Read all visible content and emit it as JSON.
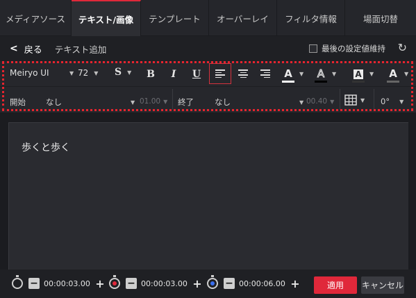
{
  "tabs": [
    "メディアソース",
    "テキスト/画像",
    "テンプレート",
    "オーバーレイ",
    "フィルタ情報",
    "場面切替"
  ],
  "back_label": "戻る",
  "breadcrumb": "テキスト追加",
  "keep_last_settings": "最後の設定値維持",
  "toolbar": {
    "font": "Meiryo UI",
    "size": "72",
    "style": "S",
    "bold": "B",
    "italic": "I",
    "underline": "U",
    "color_glyph": "A"
  },
  "row2": {
    "start_label": "開始",
    "start_value": "なし",
    "start_duration": "01.00",
    "end_label": "終了",
    "end_value": "なし",
    "end_duration": "00.40",
    "rotation": "0°"
  },
  "preview_text": "歩くと歩く",
  "timers": [
    "00:00:03.00",
    "00:00:03.00",
    "00:00:06.00"
  ],
  "apply_label": "適用",
  "cancel_label": "キャンセル",
  "colors": {
    "accent": "#e0283a",
    "text_color": "#ffffff",
    "outline_color": "#000000",
    "background_color": "#333333",
    "shadow_color": "#666666"
  }
}
